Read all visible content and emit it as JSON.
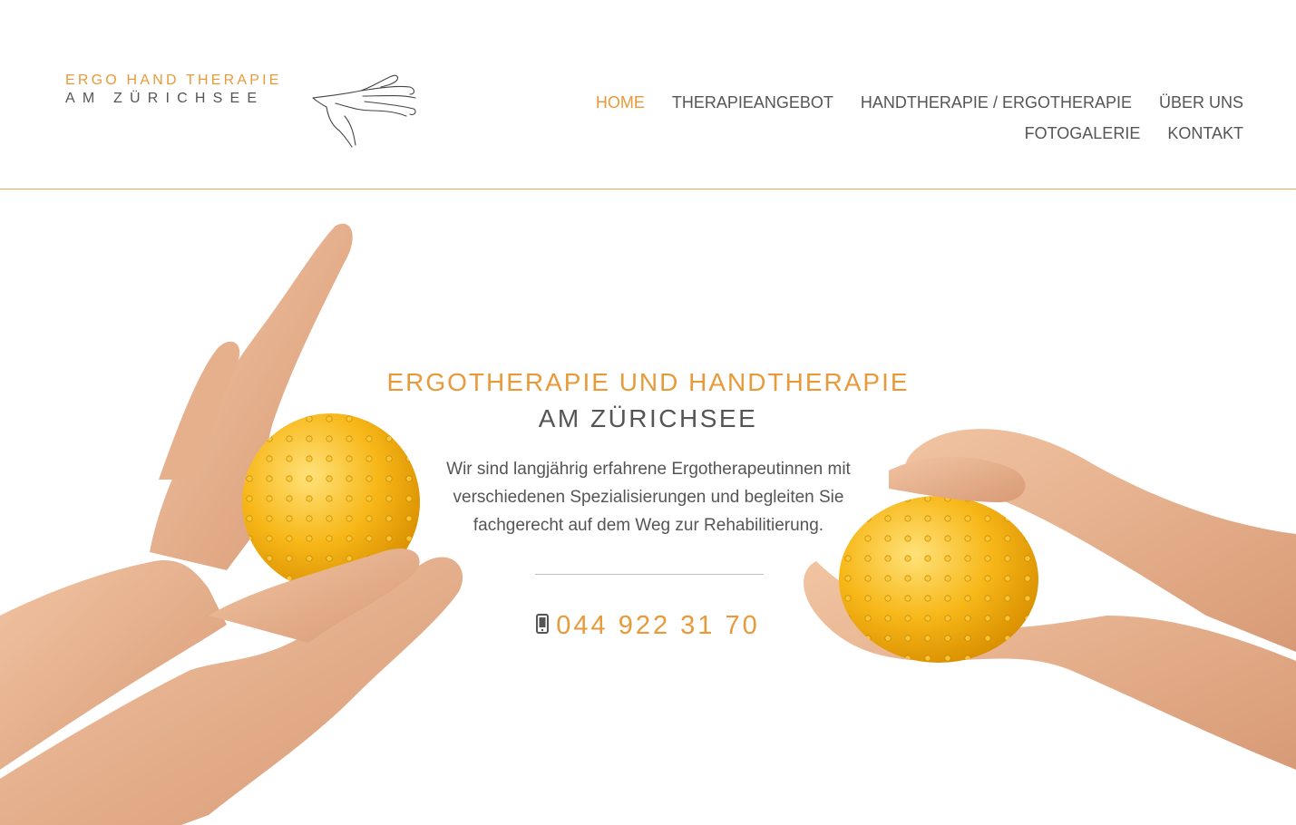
{
  "logo": {
    "line1": "ERGO HAND THERAPIE",
    "line2": "AM ZÜRICHSEE"
  },
  "nav": {
    "items": [
      {
        "label": "HOME",
        "active": true
      },
      {
        "label": "THERAPIEANGEBOT",
        "active": false
      },
      {
        "label": "HANDTHERAPIE / ERGOTHERAPIE",
        "active": false
      },
      {
        "label": "ÜBER UNS",
        "active": false
      },
      {
        "label": "FOTOGALERIE",
        "active": false
      },
      {
        "label": "KONTAKT",
        "active": false
      }
    ]
  },
  "hero": {
    "title": "ERGOTHERAPIE UND HANDTHERAPIE",
    "subtitle": "AM ZÜRICHSEE",
    "text": "Wir sind langjährig erfahrene Ergotherapeutinnen mit verschiedenen Spezialisierungen und begleiten Sie fachgerecht auf dem Weg zur Rehabilitierung.",
    "phone": "044 922 31 70",
    "phone_icon": "mobile-phone-icon"
  },
  "colors": {
    "accent": "#e89a3a",
    "text": "#555555",
    "ball": "#f5b318"
  }
}
